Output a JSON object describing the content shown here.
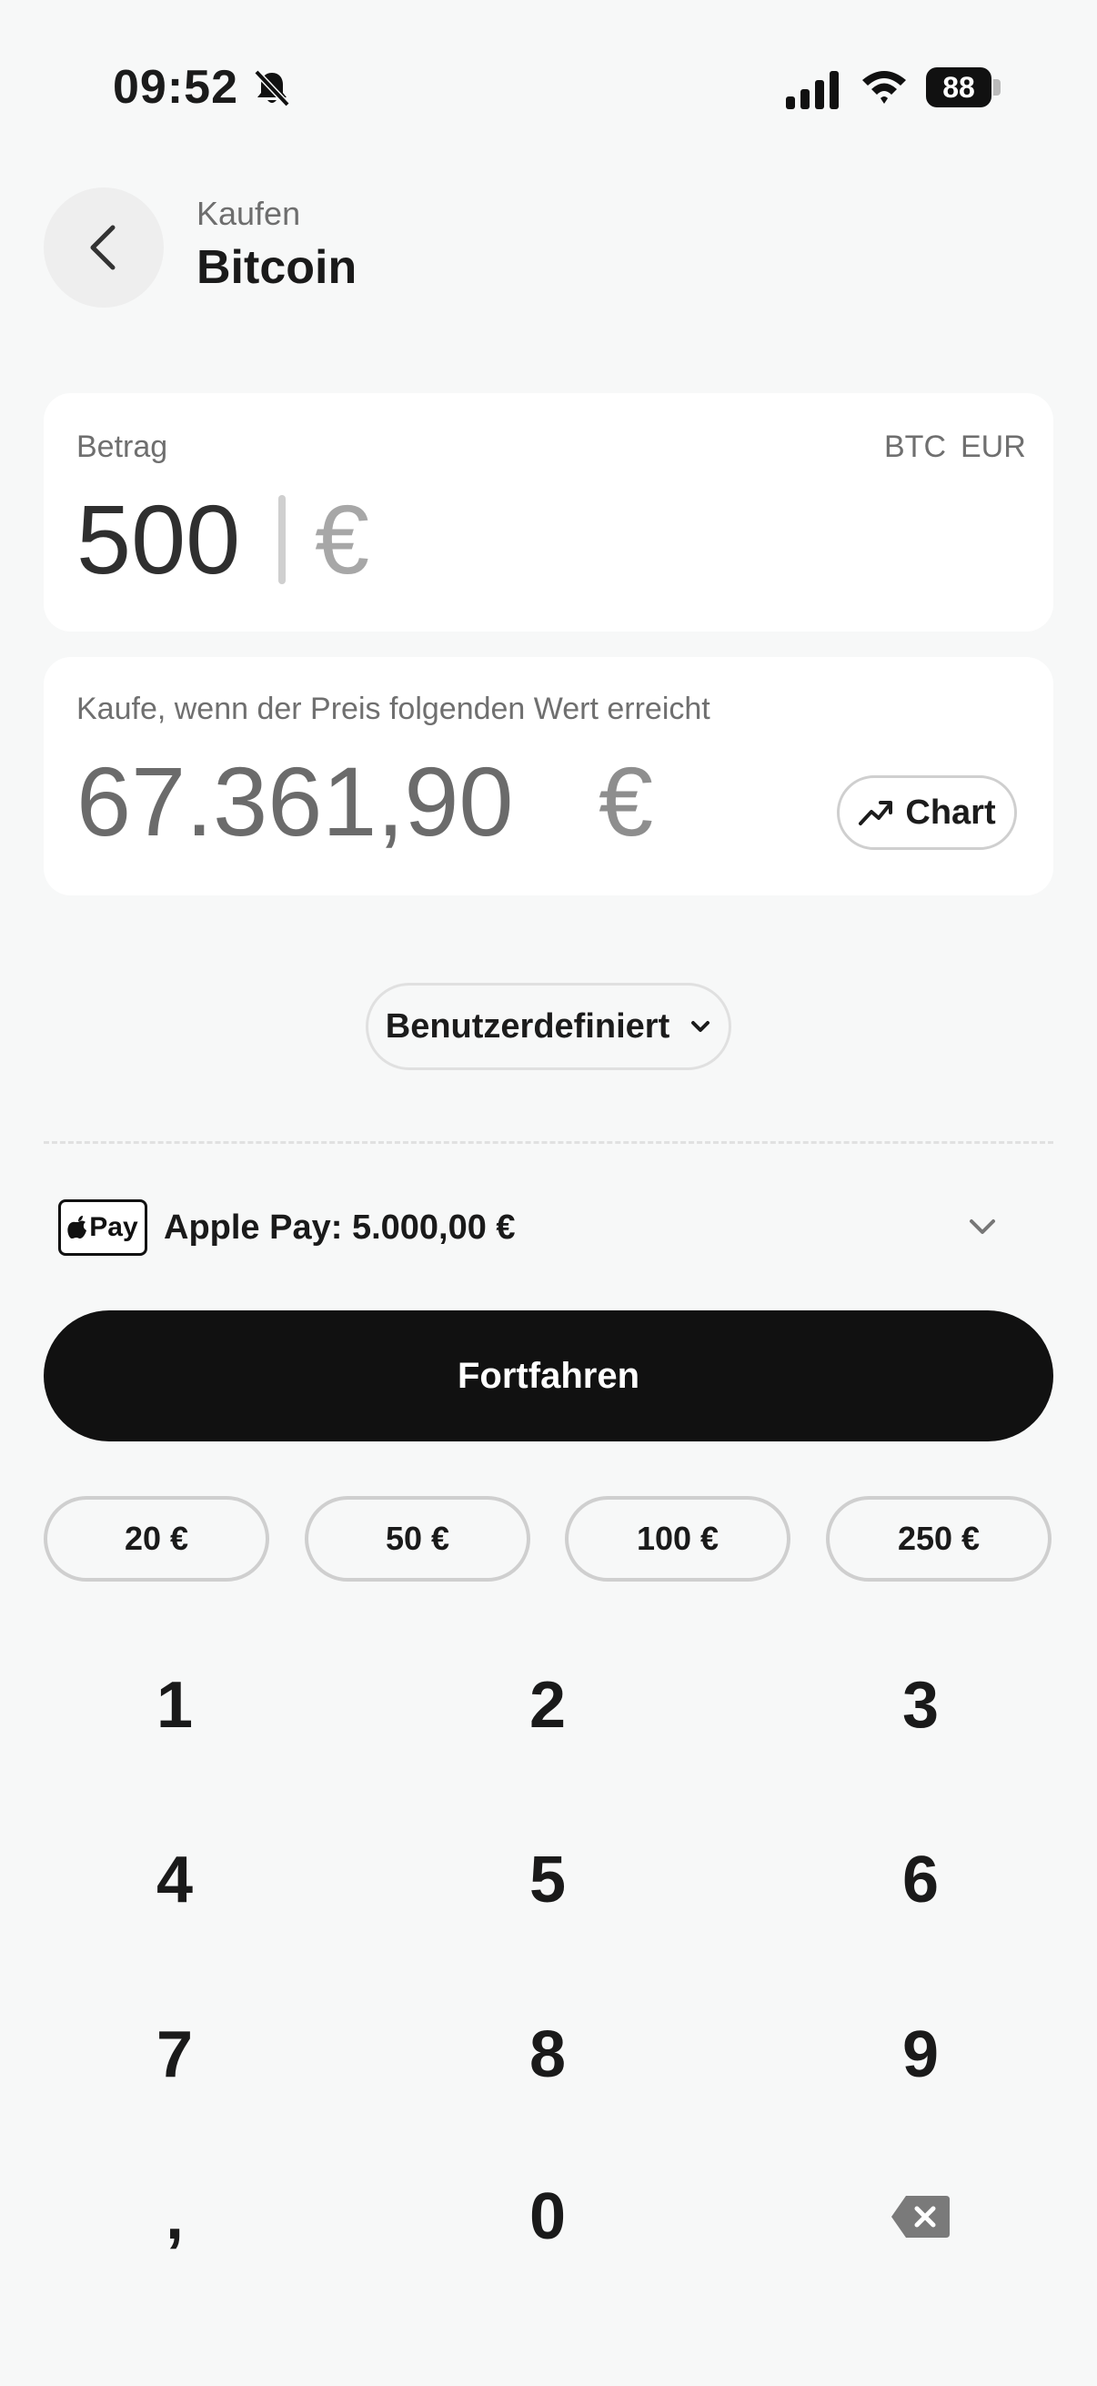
{
  "status": {
    "time": "09:52",
    "battery": "88"
  },
  "header": {
    "subtitle": "Kaufen",
    "title": "Bitcoin"
  },
  "amount": {
    "label": "Betrag",
    "unit_btc": "BTC",
    "unit_eur": "EUR",
    "value": "500",
    "currency": "€"
  },
  "limit": {
    "label": "Kaufe, wenn der Preis folgenden Wert erreicht",
    "value": "67.361,90",
    "currency": "€",
    "chart_label": "Chart"
  },
  "preset": {
    "selected": "Benutzerdefiniert"
  },
  "payment": {
    "badge": "Pay",
    "text": "Apple Pay: 5.000,00 €"
  },
  "cta": {
    "label": "Fortfahren"
  },
  "quick_amounts": [
    "20 €",
    "50 €",
    "100 €",
    "250 €"
  ],
  "keypad": [
    "1",
    "2",
    "3",
    "4",
    "5",
    "6",
    "7",
    "8",
    "9",
    ",",
    "0"
  ]
}
